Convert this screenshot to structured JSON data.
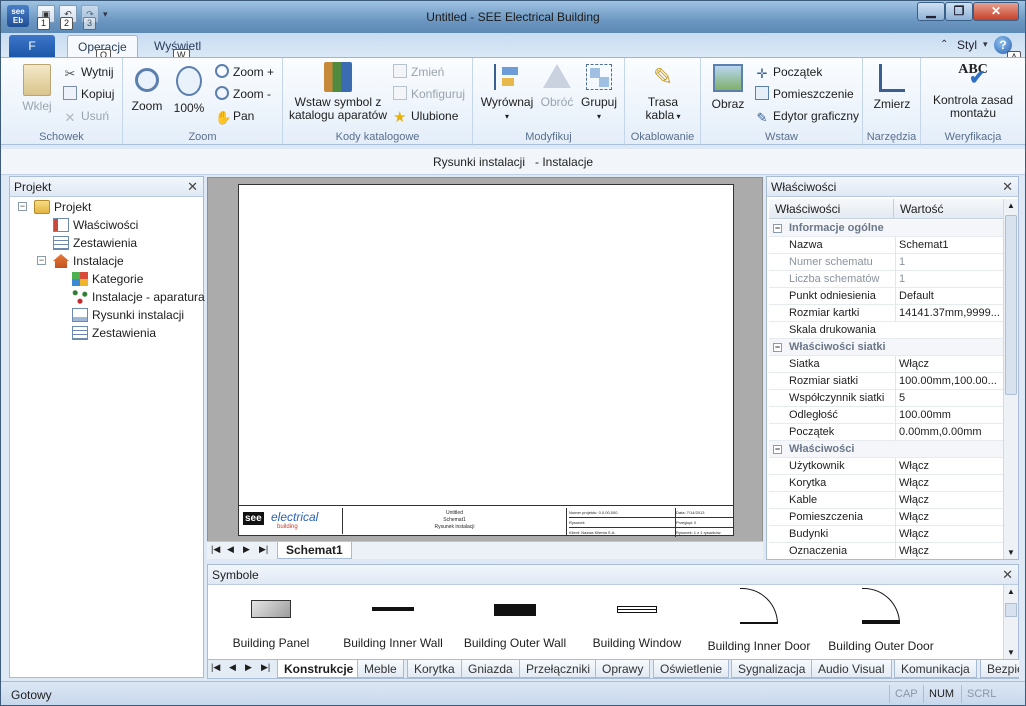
{
  "window": {
    "title": "Untitled - SEE Electrical Building",
    "app_icon": "see-eb-icon",
    "app_icon_text": "see\nEb"
  },
  "qat": {
    "keytips": [
      "1",
      "2",
      "3"
    ]
  },
  "ribbon_tabs": {
    "file": "F",
    "tabs": [
      "Operacje",
      "Wyświetl"
    ],
    "active": "Operacje",
    "keytip_ops": "O",
    "keytip_view": "W",
    "style": "Styl",
    "keytip_help": "A"
  },
  "groups": {
    "schowek": {
      "label": "Schowek",
      "paste": "Wklej",
      "cut": "Wytnij",
      "copy": "Kopiuj",
      "delete": "Usuń"
    },
    "zoom": {
      "label": "Zoom",
      "zoom": "Zoom",
      "percent": "100%",
      "zoom_in": "Zoom +",
      "zoom_out": "Zoom -",
      "pan": "Pan"
    },
    "kody": {
      "label": "Kody katalogowe",
      "insert": "Wstaw symbol z\nkatalogu aparatów",
      "change": "Zmień",
      "configure": "Konfiguruj",
      "favorites": "Ulubione"
    },
    "modyfikuj": {
      "label": "Modyfikuj",
      "align": "Wyrównaj",
      "rotate": "Obróć",
      "group": "Grupuj"
    },
    "okablowanie": {
      "label": "Okablowanie",
      "route": "Trasa\nkabla"
    },
    "wstaw": {
      "label": "Wstaw",
      "image": "Obraz",
      "origin": "Początek",
      "room": "Pomieszczenie",
      "editor": "Edytor graficzny"
    },
    "narzedzia": {
      "label": "Narzędzia",
      "change": "Zmierz"
    },
    "weryfikacja": {
      "label": "Weryfikacja",
      "check": "Kontrola zasad\nmontażu"
    }
  },
  "doc_title": "Rysunki instalacji   - Instalacje",
  "project_panel": {
    "title": "Projekt",
    "tree": [
      {
        "label": "Projekt",
        "level": 0,
        "icon": "folder-icon",
        "toggle": "−"
      },
      {
        "label": "Właściwości",
        "level": 1,
        "icon": "properties-icon"
      },
      {
        "label": "Zestawienia",
        "level": 1,
        "icon": "list-icon"
      },
      {
        "label": "Instalacje",
        "level": 1,
        "icon": "house-icon",
        "toggle": "−"
      },
      {
        "label": "Kategorie",
        "level": 2,
        "icon": "categories-icon"
      },
      {
        "label": "Instalacje - aparatura",
        "level": 2,
        "icon": "devices-icon"
      },
      {
        "label": "Rysunki instalacji",
        "level": 2,
        "icon": "drawing-icon"
      },
      {
        "label": "Zestawienia",
        "level": 2,
        "icon": "list-icon"
      }
    ]
  },
  "titleblock": {
    "logo_see": "see",
    "logo_text": "electrical",
    "logo_sub": "building",
    "center": [
      "Untitled",
      "Schemat1",
      "Rysunek instalacji"
    ],
    "cells": [
      "Numer projektu: 0.0.00.000",
      "Data: 7/14/2013",
      "Rysunek",
      "Przegląd: 0",
      "Klient: Nazwa Klienta S.A.",
      "Rysunek: 1 z 1 rysunków"
    ]
  },
  "sheet_tab": "Schemat1",
  "properties": {
    "title": "Właściwości",
    "col_key": "Właściwości",
    "col_val": "Wartość",
    "rows": [
      {
        "k": "Informacje ogólne",
        "cat": true
      },
      {
        "k": "Nazwa",
        "v": "Schemat1"
      },
      {
        "k": "Numer schematu",
        "v": "1",
        "dim": true
      },
      {
        "k": "Liczba schematów",
        "v": "1",
        "dim": true
      },
      {
        "k": "Punkt odniesienia",
        "v": "Default"
      },
      {
        "k": "Rozmiar kartki",
        "v": "14141.37mm,9999..."
      },
      {
        "k": "Skala drukowania",
        "v": ""
      },
      {
        "k": "Właściwości siatki",
        "cat": true
      },
      {
        "k": "Siatka",
        "v": "Włącz"
      },
      {
        "k": "Rozmiar siatki",
        "v": "100.00mm,100.00..."
      },
      {
        "k": "Współczynnik siatki",
        "v": "5"
      },
      {
        "k": "Odległość",
        "v": "100.00mm"
      },
      {
        "k": "Początek",
        "v": "0.00mm,0.00mm"
      },
      {
        "k": "Właściwości",
        "cat": true
      },
      {
        "k": "Użytkownik",
        "v": "Włącz"
      },
      {
        "k": "Korytka",
        "v": "Włącz"
      },
      {
        "k": "Kable",
        "v": "Włącz"
      },
      {
        "k": "Pomieszczenia",
        "v": "Włącz"
      },
      {
        "k": "Budynki",
        "v": "Włącz"
      },
      {
        "k": "Oznaczenia",
        "v": "Włącz"
      }
    ]
  },
  "symbols": {
    "title": "Symbole",
    "items": [
      "Building Panel",
      "Building Inner Wall",
      "Building Outer Wall",
      "Building Window",
      "Building Inner Door",
      "Building Outer Door"
    ],
    "tabs": [
      "Konstrukcje",
      "Meble",
      "Korytka",
      "Gniazda",
      "Przełączniki",
      "Oprawy",
      "Oświetlenie",
      "Sygnalizacja",
      "Audio Visual",
      "Komunikacja",
      "Bezpie"
    ],
    "active_tab": "Konstrukcje"
  },
  "status": {
    "text": "Gotowy",
    "cap": "CAP",
    "num": "NUM",
    "scrl": "SCRL"
  }
}
